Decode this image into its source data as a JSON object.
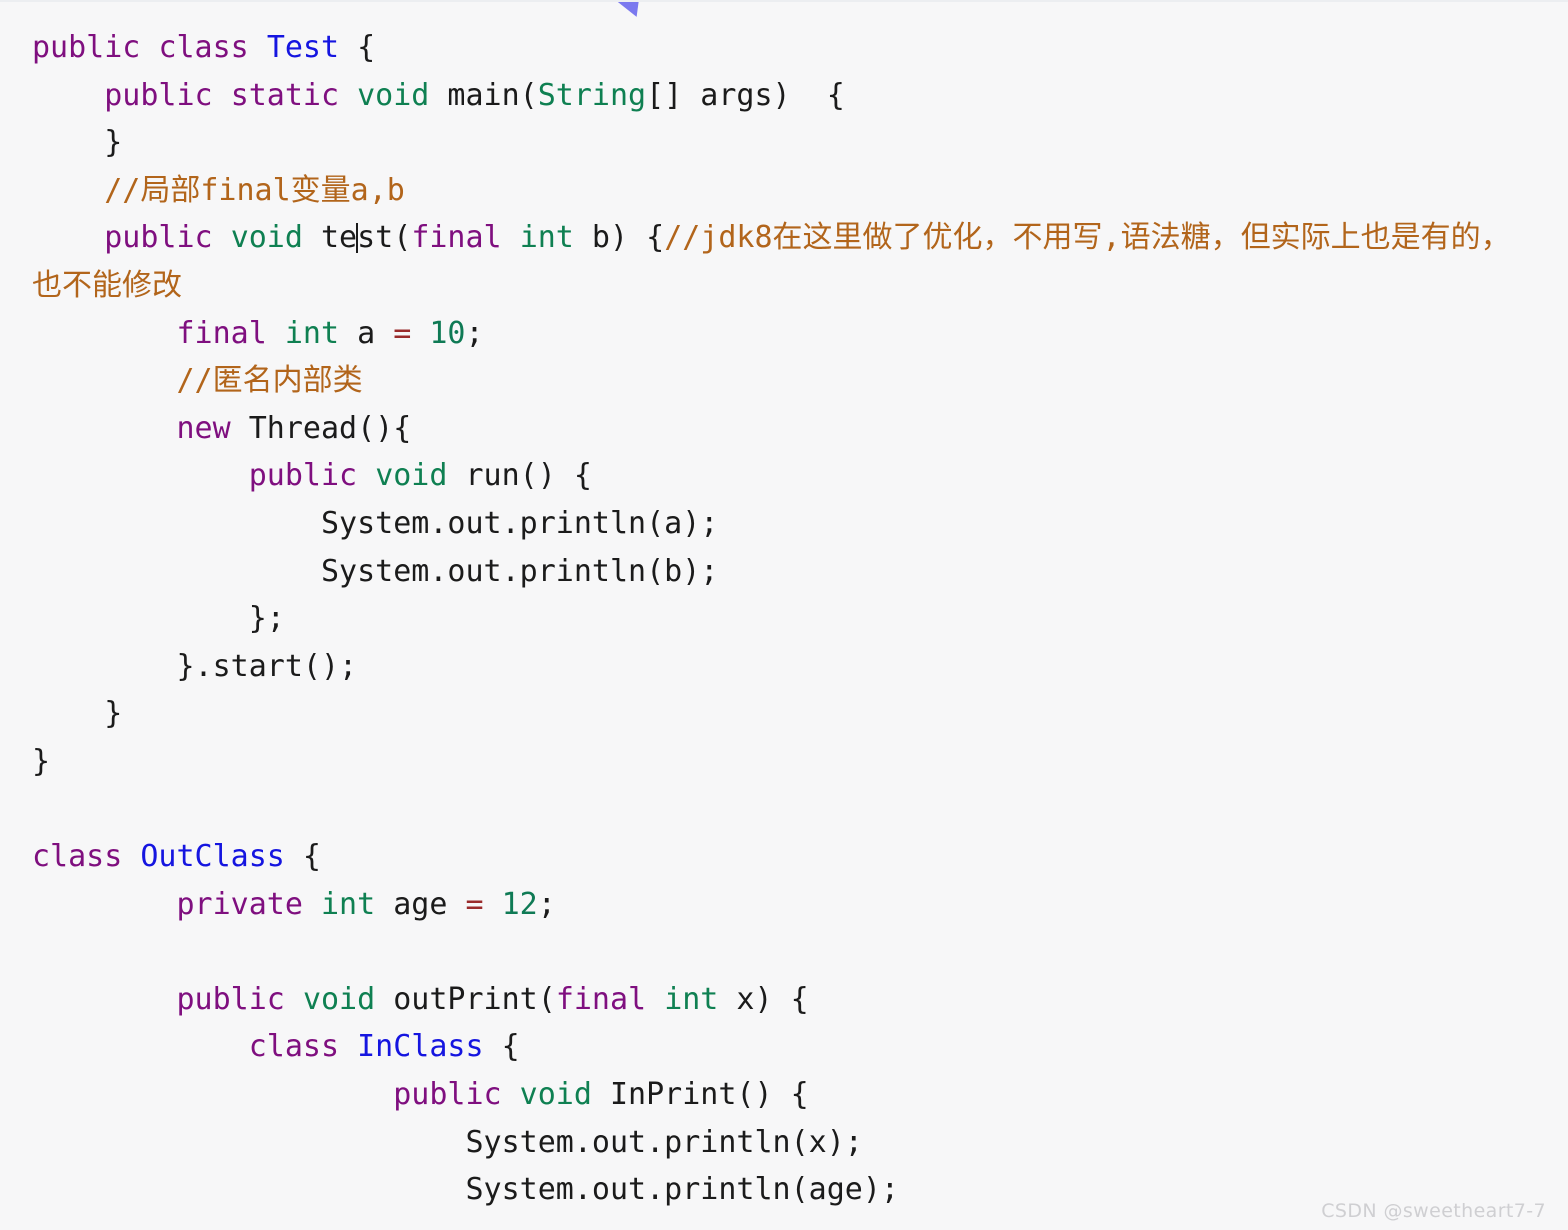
{
  "meta": {
    "background_color": "#f7f7f8",
    "language": "java",
    "cursor_color": "#7b79ef"
  },
  "theme": {
    "keyword": "#7f0f7f",
    "type": "#0f8052",
    "class_name": "#1515e0",
    "number": "#0f7a55",
    "operator": "#9a2b2b",
    "comment": "#b2651b",
    "plain": "#1b1b1b"
  },
  "watermark": {
    "text": "CSDN @sweetheart7-7"
  },
  "code": {
    "lines": [
      {
        "id": "l1",
        "text": "public class Test {"
      },
      {
        "id": "l2",
        "text": "    public static void main(String[] args)  {"
      },
      {
        "id": "l3",
        "text": "    }"
      },
      {
        "id": "l4",
        "text": "    //局部final变量a,b"
      },
      {
        "id": "l5",
        "text": "    public void test(final int b) {//jdk8在这里做了优化，不用写,语法糖，但实际上也是有的，也不能修改"
      },
      {
        "id": "l6",
        "text": "        final int a = 10;"
      },
      {
        "id": "l7",
        "text": "        //匿名内部类"
      },
      {
        "id": "l8",
        "text": "        new Thread(){"
      },
      {
        "id": "l9",
        "text": "            public void run() {"
      },
      {
        "id": "l10",
        "text": "                System.out.println(a);"
      },
      {
        "id": "l11",
        "text": "                System.out.println(b);"
      },
      {
        "id": "l12",
        "text": "            };"
      },
      {
        "id": "l13",
        "text": "        }.start();"
      },
      {
        "id": "l14",
        "text": "    }"
      },
      {
        "id": "l15",
        "text": "}"
      },
      {
        "id": "l16",
        "text": ""
      },
      {
        "id": "l17",
        "text": "class OutClass {"
      },
      {
        "id": "l18",
        "text": "        private int age = 12;"
      },
      {
        "id": "l19",
        "text": ""
      },
      {
        "id": "l20",
        "text": "        public void outPrint(final int x) {"
      },
      {
        "id": "l21",
        "text": "            class InClass {"
      },
      {
        "id": "l22",
        "text": "                    public void InPrint() {"
      },
      {
        "id": "l23",
        "text": "                        System.out.println(x);"
      },
      {
        "id": "l24",
        "text": "                        System.out.println(age);"
      }
    ],
    "tokens": {
      "l1": [
        {
          "t": "public",
          "c": "kw"
        },
        {
          "t": " ",
          "c": "pln"
        },
        {
          "t": "class",
          "c": "kw"
        },
        {
          "t": " ",
          "c": "pln"
        },
        {
          "t": "Test",
          "c": "cls"
        },
        {
          "t": " {",
          "c": "pln"
        }
      ],
      "l2": [
        {
          "t": "    ",
          "c": "pln"
        },
        {
          "t": "public",
          "c": "kw"
        },
        {
          "t": " ",
          "c": "pln"
        },
        {
          "t": "static",
          "c": "kw"
        },
        {
          "t": " ",
          "c": "pln"
        },
        {
          "t": "void",
          "c": "typ"
        },
        {
          "t": " main(",
          "c": "pln"
        },
        {
          "t": "String",
          "c": "typ"
        },
        {
          "t": "[] args)  {",
          "c": "pln"
        }
      ],
      "l3": [
        {
          "t": "    }",
          "c": "pln"
        }
      ],
      "l4": [
        {
          "t": "    ",
          "c": "pln"
        },
        {
          "t": "//局部final变量a,b",
          "c": "cmt"
        }
      ],
      "l5": [
        {
          "t": "    ",
          "c": "pln"
        },
        {
          "t": "public",
          "c": "kw"
        },
        {
          "t": " ",
          "c": "pln"
        },
        {
          "t": "void",
          "c": "typ"
        },
        {
          "t": " te",
          "c": "pln"
        },
        {
          "t": "|CARET|",
          "c": "caret"
        },
        {
          "t": "st(",
          "c": "pln"
        },
        {
          "t": "final",
          "c": "kw"
        },
        {
          "t": " ",
          "c": "pln"
        },
        {
          "t": "int",
          "c": "typ"
        },
        {
          "t": " b) {",
          "c": "pln"
        },
        {
          "t": "//jdk8在这里做了优化，不用写,语法糖，但实际上也是有的，也不能修改",
          "c": "cmt"
        }
      ],
      "l6": [
        {
          "t": "        ",
          "c": "pln"
        },
        {
          "t": "final",
          "c": "kw"
        },
        {
          "t": " ",
          "c": "pln"
        },
        {
          "t": "int",
          "c": "typ"
        },
        {
          "t": " a ",
          "c": "pln"
        },
        {
          "t": "=",
          "c": "op"
        },
        {
          "t": " ",
          "c": "pln"
        },
        {
          "t": "10",
          "c": "num"
        },
        {
          "t": ";",
          "c": "pln"
        }
      ],
      "l7": [
        {
          "t": "        ",
          "c": "pln"
        },
        {
          "t": "//匿名内部类",
          "c": "cmt"
        }
      ],
      "l8": [
        {
          "t": "        ",
          "c": "pln"
        },
        {
          "t": "new",
          "c": "kw"
        },
        {
          "t": " Thread(){",
          "c": "pln"
        }
      ],
      "l9": [
        {
          "t": "            ",
          "c": "pln"
        },
        {
          "t": "public",
          "c": "kw"
        },
        {
          "t": " ",
          "c": "pln"
        },
        {
          "t": "void",
          "c": "typ"
        },
        {
          "t": " run() {",
          "c": "pln"
        }
      ],
      "l10": [
        {
          "t": "                System.out.println(a);",
          "c": "pln"
        }
      ],
      "l11": [
        {
          "t": "                System.out.println(b);",
          "c": "pln"
        }
      ],
      "l12": [
        {
          "t": "            };",
          "c": "pln"
        }
      ],
      "l13": [
        {
          "t": "        }.start();",
          "c": "pln"
        }
      ],
      "l14": [
        {
          "t": "    }",
          "c": "pln"
        }
      ],
      "l15": [
        {
          "t": "}",
          "c": "pln"
        }
      ],
      "l16": [
        {
          "t": " ",
          "c": "pln"
        }
      ],
      "l17": [
        {
          "t": "class",
          "c": "kw"
        },
        {
          "t": " ",
          "c": "pln"
        },
        {
          "t": "OutClass",
          "c": "cls"
        },
        {
          "t": " {",
          "c": "pln"
        }
      ],
      "l18": [
        {
          "t": "        ",
          "c": "pln"
        },
        {
          "t": "private",
          "c": "kw"
        },
        {
          "t": " ",
          "c": "pln"
        },
        {
          "t": "int",
          "c": "typ"
        },
        {
          "t": " age ",
          "c": "pln"
        },
        {
          "t": "=",
          "c": "op"
        },
        {
          "t": " ",
          "c": "pln"
        },
        {
          "t": "12",
          "c": "num"
        },
        {
          "t": ";",
          "c": "pln"
        }
      ],
      "l19": [
        {
          "t": " ",
          "c": "pln"
        }
      ],
      "l20": [
        {
          "t": "        ",
          "c": "pln"
        },
        {
          "t": "public",
          "c": "kw"
        },
        {
          "t": " ",
          "c": "pln"
        },
        {
          "t": "void",
          "c": "typ"
        },
        {
          "t": " outPrint(",
          "c": "pln"
        },
        {
          "t": "final",
          "c": "kw"
        },
        {
          "t": " ",
          "c": "pln"
        },
        {
          "t": "int",
          "c": "typ"
        },
        {
          "t": " x) {",
          "c": "pln"
        }
      ],
      "l21": [
        {
          "t": "            ",
          "c": "pln"
        },
        {
          "t": "class",
          "c": "kw"
        },
        {
          "t": " ",
          "c": "pln"
        },
        {
          "t": "InClass",
          "c": "cls"
        },
        {
          "t": " {",
          "c": "pln"
        }
      ],
      "l22": [
        {
          "t": "                    ",
          "c": "pln"
        },
        {
          "t": "public",
          "c": "kw"
        },
        {
          "t": " ",
          "c": "pln"
        },
        {
          "t": "void",
          "c": "typ"
        },
        {
          "t": " InPrint() {",
          "c": "pln"
        }
      ],
      "l23": [
        {
          "t": "                        System.out.println(x);",
          "c": "pln"
        }
      ],
      "l24": [
        {
          "t": "                        System.out.println(age);",
          "c": "pln"
        }
      ]
    }
  }
}
